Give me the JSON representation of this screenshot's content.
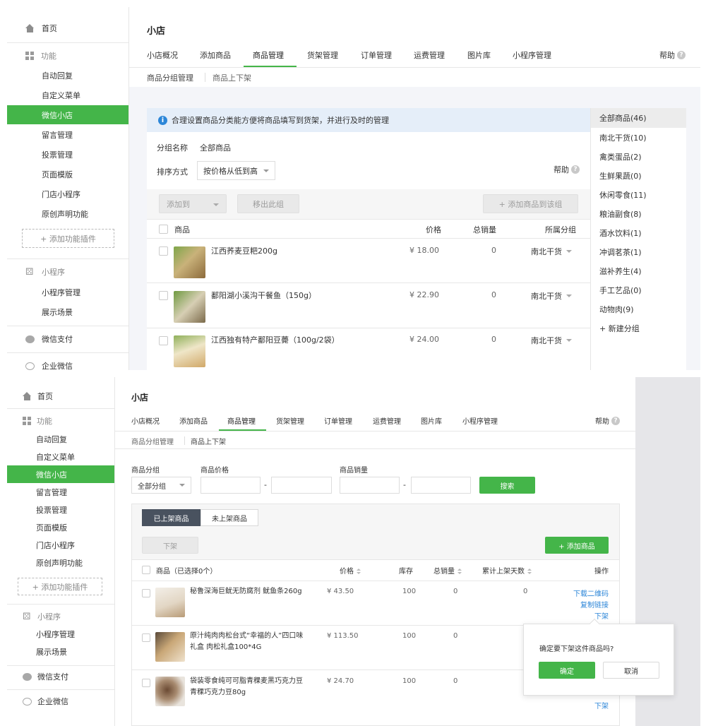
{
  "colors": {
    "accent": "#44b549",
    "link": "#2c86d8",
    "dark_tab": "#49525f",
    "notice_bg": "#e5eef9"
  },
  "sidebar": {
    "home": "首页",
    "features_head": "功能",
    "features": [
      "自动回复",
      "自定义菜单",
      "微信小店",
      "留言管理",
      "投票管理",
      "页面模版",
      "门店小程序",
      "原创声明功能"
    ],
    "active": "微信小店",
    "add_plugin": "+ 添加功能插件",
    "mini_head": "小程序",
    "mini": [
      "小程序管理",
      "展示场景"
    ],
    "pay": "微信支付",
    "work": "企业微信",
    "icons": {
      "home": "home-icon",
      "features": "grid-icon",
      "mini": "link-icon",
      "pay": "pay-icon",
      "work": "chat-icon"
    }
  },
  "header": {
    "title": "小店",
    "tabs": [
      "小店概况",
      "添加商品",
      "商品管理",
      "货架管理",
      "订单管理",
      "运费管理",
      "图片库",
      "小程序管理"
    ],
    "active_tab": "商品管理",
    "help": "帮助",
    "subtabs": [
      "商品分组管理",
      "商品上下架"
    ]
  },
  "panel1": {
    "notice": "合理设置商品分类能方便将商品填写到货架，并进行及时的管理",
    "group_name_label": "分组名称",
    "group_name_value": "全部商品",
    "sort_label": "排序方式",
    "sort_value": "按价格从低到高",
    "help": "帮助",
    "btn_add_to": "添加到",
    "btn_remove": "移出此组",
    "btn_add_goods": "+ 添加商品到该组",
    "columns": [
      "商品",
      "价格",
      "总销量",
      "所属分组"
    ],
    "rows": [
      {
        "name": "江西荞麦豆粑200g",
        "price": "¥ 18.00",
        "sales": "0",
        "group": "南北干货"
      },
      {
        "name": "鄱阳湖小溪沟干餐鱼（150g）",
        "price": "¥ 22.90",
        "sales": "0",
        "group": "南北干货"
      },
      {
        "name": "江西独有特产鄱阳豆薨（100g/2袋）",
        "price": "¥ 24.00",
        "sales": "0",
        "group": "南北干货"
      }
    ],
    "categories": [
      "全部商品(46)",
      "南北干货(10)",
      "禽类蛋品(2)",
      "生鲜果蔬(0)",
      "休闲零食(11)",
      "粮油副食(8)",
      "酒水饮料(1)",
      "冲调茗茶(1)",
      "滋补养生(4)",
      "手工艺品(0)",
      "动物肉(9)"
    ],
    "new_group": "+ 新建分组"
  },
  "panel2": {
    "filter_group_label": "商品分组",
    "filter_group_value": "全部分组",
    "filter_price_label": "商品价格",
    "filter_sales_label": "商品销量",
    "dash": "-",
    "search_btn": "搜索",
    "tab_on": "已上架商品",
    "tab_off": "未上架商品",
    "btn_down": "下架",
    "btn_add": "+ 添加商品",
    "columns": [
      "商品（已选择0个）",
      "价格",
      "库存",
      "总销量",
      "累计上架天数",
      "操作"
    ],
    "rows": [
      {
        "name": "秘鲁深海巨鱿无防腐剂 鱿鱼条260g",
        "price": "¥ 43.50",
        "stock": "100",
        "sales": "0",
        "days": "0",
        "ops": [
          "下载二维码",
          "复制链接",
          "下架"
        ]
      },
      {
        "name": "原汁纯肉肉松台式“幸福的人”四口味礼盒 肉松礼盒100*4G",
        "price": "¥ 113.50",
        "stock": "100",
        "sales": "0",
        "days": "",
        "ops": []
      },
      {
        "name": "袋装零食纯可可脂青稞麦黑巧克力豆 青稞巧克力豆80g",
        "price": "¥ 24.70",
        "stock": "100",
        "sales": "0",
        "days": "",
        "ops": [
          "下架"
        ]
      }
    ],
    "popover": {
      "question": "确定要下架这件商品吗?",
      "confirm": "确定",
      "cancel": "取消"
    }
  }
}
